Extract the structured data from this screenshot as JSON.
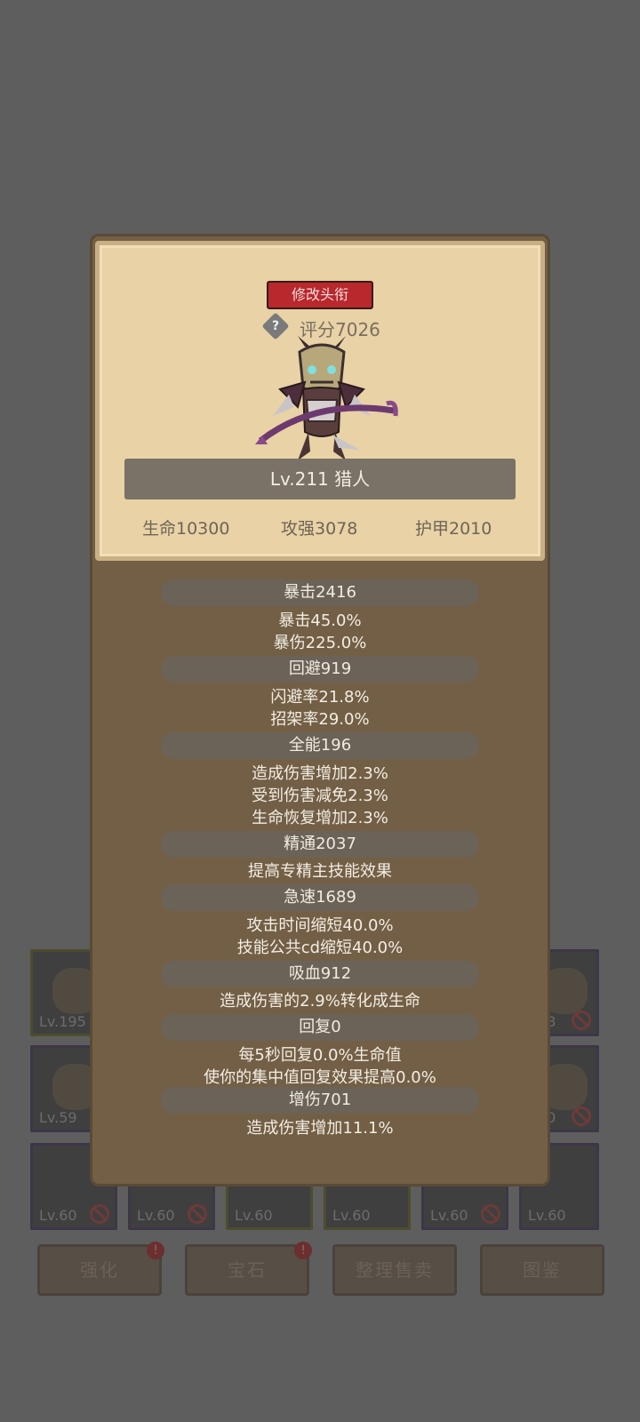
{
  "card": {
    "title_button": "修改头衔",
    "help_icon": "?",
    "score": "评分7026",
    "name": "Lv.211 猎人",
    "base_stats": [
      "生命10300",
      "攻强3078",
      "护甲2010"
    ]
  },
  "stat_groups": [
    {
      "head": "暴击2416",
      "lines": [
        "暴击45.0%",
        "暴伤225.0%"
      ]
    },
    {
      "head": "回避919",
      "lines": [
        "闪避率21.8%",
        "招架率29.0%"
      ]
    },
    {
      "head": "全能196",
      "lines": [
        "造成伤害增加2.3%",
        "受到伤害减免2.3%",
        "生命恢复增加2.3%"
      ]
    },
    {
      "head": "精通2037",
      "lines": [
        "提高专精主技能效果"
      ]
    },
    {
      "head": "急速1689",
      "lines": [
        "攻击时间缩短40.0%",
        "技能公共cd缩短40.0%"
      ]
    },
    {
      "head": "吸血912",
      "lines": [
        "造成伤害的2.9%转化成生命"
      ]
    },
    {
      "head": "回复0",
      "lines": [
        "每5秒回复0.0%生命值",
        "使你的集中值回复效果提高0.0%"
      ]
    },
    {
      "head": "增伤701",
      "lines": [
        "造成伤害增加11.1%"
      ]
    }
  ],
  "inventory": {
    "row1": [
      "Lv.195",
      "58"
    ],
    "row2": [
      "Lv.59",
      "60"
    ],
    "row3": [
      "Lv.60",
      "Lv.60",
      "Lv.60",
      "Lv.60",
      "Lv.60",
      "Lv.60"
    ]
  },
  "bottom_buttons": [
    {
      "label": "强化",
      "badge": "!"
    },
    {
      "label": "宝石",
      "badge": "!"
    },
    {
      "label": "整理售卖",
      "badge": ""
    },
    {
      "label": "图鉴",
      "badge": ""
    }
  ],
  "colors": {
    "background": "#5e5e5e",
    "panel": "#725f45",
    "card": "#e8d2a6",
    "title_button": "#b8282c",
    "stat_head": "#6b6358"
  }
}
